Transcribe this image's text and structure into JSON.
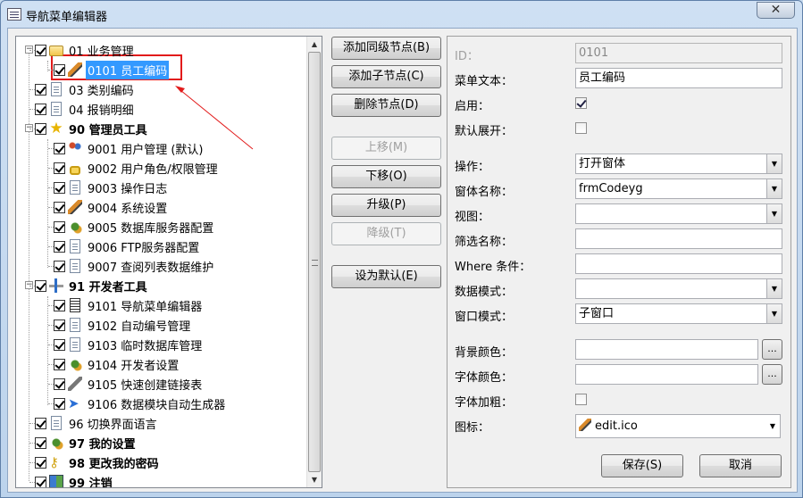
{
  "window": {
    "title": "导航菜单编辑器",
    "close_symbol": "✕"
  },
  "tree": {
    "items": [
      {
        "label": "01 业务管理",
        "icon": "folder-icon",
        "bold": false
      },
      {
        "label": "0101 员工编码",
        "icon": "pencil-icon",
        "bold": false,
        "selected": true
      },
      {
        "label": "03 类别编码",
        "icon": "document-icon",
        "bold": false
      },
      {
        "label": "04 报销明细",
        "icon": "document-icon",
        "bold": false
      },
      {
        "label": "90 管理员工具",
        "icon": "star-icon",
        "bold": true
      },
      {
        "label": "9001 用户管理 (默认)",
        "icon": "users-icon",
        "bold": false
      },
      {
        "label": "9002 用户角色/权限管理",
        "icon": "lock-icon",
        "bold": false
      },
      {
        "label": "9003 操作日志",
        "icon": "document-icon",
        "bold": false
      },
      {
        "label": "9004 系统设置",
        "icon": "settings-icon",
        "bold": false
      },
      {
        "label": "9005 数据库服务器配置",
        "icon": "gear-icon",
        "bold": false
      },
      {
        "label": "9006 FTP服务器配置",
        "icon": "document-icon",
        "bold": false
      },
      {
        "label": "9007 查阅列表数据维护",
        "icon": "document-icon",
        "bold": false
      },
      {
        "label": "91 开发者工具",
        "icon": "developer-icon",
        "bold": true
      },
      {
        "label": "9101 导航菜单编辑器",
        "icon": "list-icon",
        "bold": false
      },
      {
        "label": "9102 自动编号管理",
        "icon": "document-icon",
        "bold": false
      },
      {
        "label": "9103 临时数据库管理",
        "icon": "document-icon",
        "bold": false
      },
      {
        "label": "9104 开发者设置",
        "icon": "gear-icon",
        "bold": false
      },
      {
        "label": "9105 快速创建链接表",
        "icon": "tool-icon",
        "bold": false
      },
      {
        "label": "9106 数据模块自动生成器",
        "icon": "arrow-icon",
        "bold": false
      },
      {
        "label": "96 切换界面语言",
        "icon": "document-icon",
        "bold": false
      },
      {
        "label": "97 我的设置",
        "icon": "gear-icon",
        "bold": true
      },
      {
        "label": "98 更改我的密码",
        "icon": "key-icon",
        "bold": true
      },
      {
        "label": "99 注销",
        "icon": "book-icon",
        "bold": true
      }
    ]
  },
  "buttons": {
    "add_sibling": "添加同级节点(B)",
    "add_child": "添加子节点(C)",
    "delete_node": "删除节点(D)",
    "move_up": "上移(M)",
    "move_down": "下移(O)",
    "promote": "升级(P)",
    "demote": "降级(T)",
    "set_default": "设为默认(E)",
    "save": "保存(S)",
    "cancel": "取消"
  },
  "props": {
    "id_label": "ID：",
    "id_value": "0101",
    "menu_text_label": "菜单文本：",
    "menu_text_value": "员工编码",
    "enabled_label": "启用：",
    "enabled": true,
    "expand_label": "默认展开：",
    "expand": false,
    "operation_label": "操作：",
    "operation_value": "打开窗体",
    "form_name_label": "窗体名称：",
    "form_name_value": "frmCodeyg",
    "view_label": "视图：",
    "view_value": "",
    "filter_label": "筛选名称：",
    "filter_value": "",
    "where_label": "Where 条件：",
    "where_value": "",
    "data_mode_label": "数据模式：",
    "data_mode_value": "",
    "window_mode_label": "窗口模式：",
    "window_mode_value": "子窗口",
    "bg_color_label": "背景颜色：",
    "font_color_label": "字体颜色：",
    "bold_label": "字体加粗：",
    "bold": false,
    "icon_label": "图标：",
    "icon_value": "edit.ico",
    "dots": "..."
  },
  "colors": {
    "selection": "#3399ff",
    "highlight_box": "#e21b1b",
    "annotation_arrow": "#e21b1b"
  }
}
